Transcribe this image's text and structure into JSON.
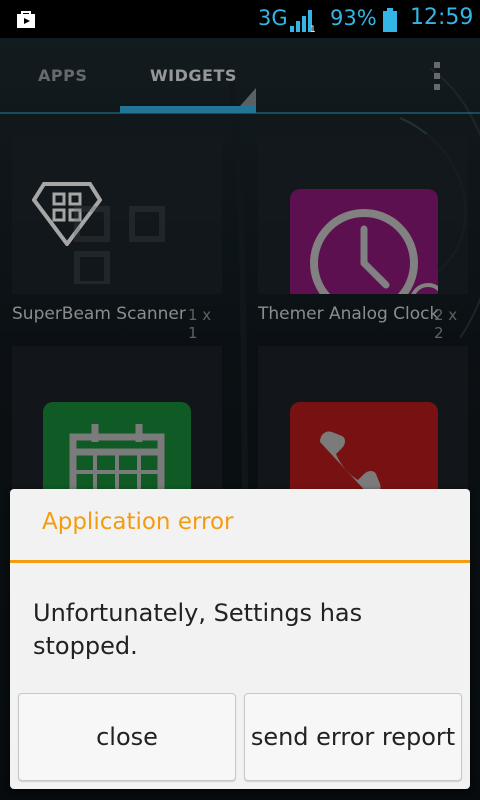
{
  "status_bar": {
    "network": "3G",
    "battery_percent": "93%",
    "time": "12:59",
    "notification_icon": "store-bag-icon",
    "signal_icon": "signal-icon",
    "battery_icon": "battery-icon",
    "accent_color": "#33b5e5"
  },
  "tabs": [
    {
      "label": "APPS"
    },
    {
      "label": "WIDGETS",
      "selected": true
    }
  ],
  "widgets": [
    {
      "name": "SuperBeam Scanner",
      "size": "1 x 1",
      "icon": "superbeam-diamond-qr-icon"
    },
    {
      "name": "Themer Analog Clock",
      "size": "2 x 2",
      "icon": "analog-clock-icon"
    },
    {
      "icon": "calendar-icon",
      "color": "#1a8a3a"
    },
    {
      "icon": "phone-icon",
      "color": "#b81c1c"
    }
  ],
  "dialog": {
    "title": "Application error",
    "message": "Unfortunately, Settings has stopped.",
    "close_label": "close",
    "report_label": "send error report",
    "accent_color": "#f39c12"
  }
}
